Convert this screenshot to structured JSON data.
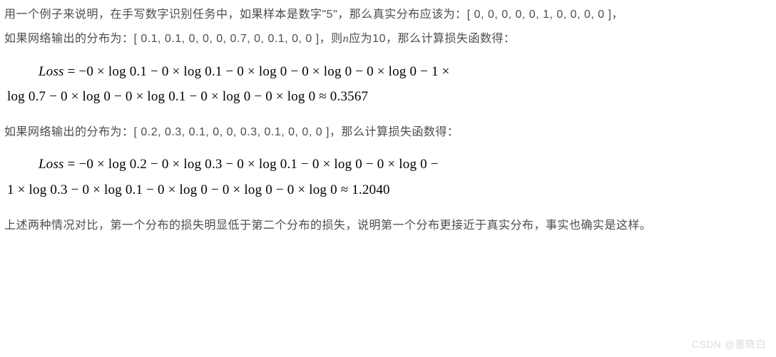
{
  "para1": "用一个例子来说明，在手写数字识别任务中，如果样本是数字\"5\"，那么真实分布应该为：[ 0, 0, 0, 0, 0, 1, 0, 0, 0, 0 ]，",
  "para2_a": "如果网络输出的分布为：[ 0.1, 0.1, 0, 0, 0, 0.7, 0, 0.1, 0, 0 ]，则",
  "para2_n": "n",
  "para2_b": "应为10，那么计算损失函数得：",
  "formula1": {
    "label": "Loss",
    "line1": " = −0 × log 0.1 − 0 × log 0.1 − 0 × log 0 − 0 × log 0 − 0 × log 0 − 1 ×",
    "line2": "log 0.7 − 0 × log 0 − 0 × log 0.1 − 0 × log 0 − 0 × log 0 ≈ 0.3567"
  },
  "para3": "如果网络输出的分布为：[ 0.2, 0.3, 0.1, 0, 0, 0.3, 0.1, 0, 0, 0 ]，那么计算损失函数得：",
  "formula2": {
    "label": "Loss",
    "line1": " = −0 × log 0.2 − 0 × log 0.3 − 0 × log 0.1 − 0 × log 0 − 0 × log 0 −",
    "line2": "1 × log 0.3 − 0 × log 0.1 − 0 × log 0 − 0 × log 0 − 0 × log 0 ≈ 1.2040"
  },
  "para4": "上述两种情况对比，第一个分布的损失明显低于第二个分布的损失，说明第一个分布更接近于真实分布，事实也确实是这样。",
  "watermark": "CSDN @墨晓白"
}
